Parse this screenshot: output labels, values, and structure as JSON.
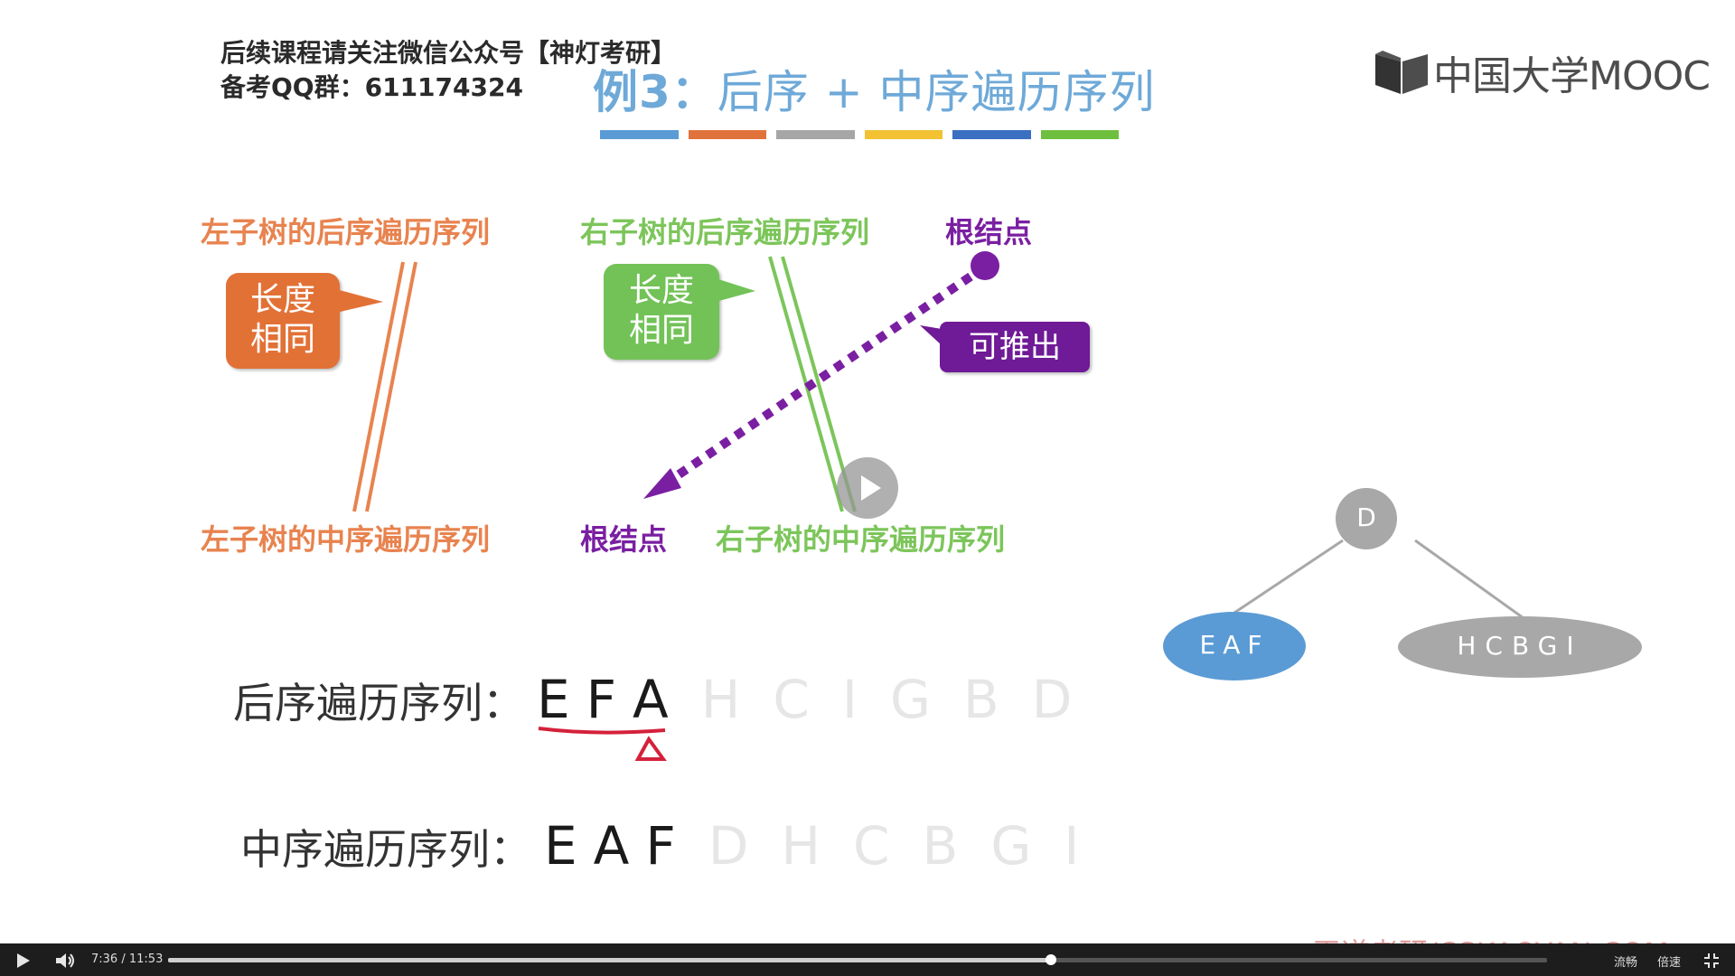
{
  "slide": {
    "notice_line1": "后续课程请关注微信公众号【神灯考研】",
    "notice_line2": "备考QQ群：611174324",
    "title_example": "例3：",
    "title_text": "后序 + 中序遍历序列",
    "color_bar": [
      "#5a9bd5",
      "#e0733c",
      "#a6a6a6",
      "#f2c233",
      "#3a6fc2",
      "#6fbf3f"
    ],
    "logo_text": "中国大学MOOC",
    "labels": {
      "left_post": "左子树的后序遍历序列",
      "right_post": "右子树的后序遍历序列",
      "root_top": "根结点",
      "left_in": "左子树的中序遍历序列",
      "root_bottom": "根结点",
      "right_in": "右子树的中序遍历序列"
    },
    "bubbles": {
      "orange_l1": "长度",
      "orange_l2": "相同",
      "green_l1": "长度",
      "green_l2": "相同",
      "purple": "可推出"
    },
    "post_seq": {
      "label": "后序遍历序列：",
      "highlight": [
        "E",
        "F",
        "A"
      ],
      "faint": [
        "H",
        "C",
        "I",
        "G",
        "B",
        "D"
      ]
    },
    "in_seq": {
      "label": "中序遍历序列：",
      "highlight": [
        "E",
        "A",
        "F"
      ],
      "faint": [
        "D",
        "H",
        "C",
        "B",
        "G",
        "I"
      ]
    },
    "tree": {
      "root": "D",
      "left": "EAF",
      "right": "HCBGI"
    },
    "watermark": "王道考研/CSKAOYAN.COM"
  },
  "player": {
    "time_current": "7:36",
    "time_sep": "/",
    "time_total": "11:53",
    "progress": 0.64,
    "quality_label": "流畅",
    "speed_label": "倍速"
  },
  "colors": {
    "orange": "#e8834f",
    "green": "#7cc55a",
    "purple": "#7a1fa2",
    "node_blue": "#5b9bd5",
    "node_gray": "#a8a8a8"
  }
}
